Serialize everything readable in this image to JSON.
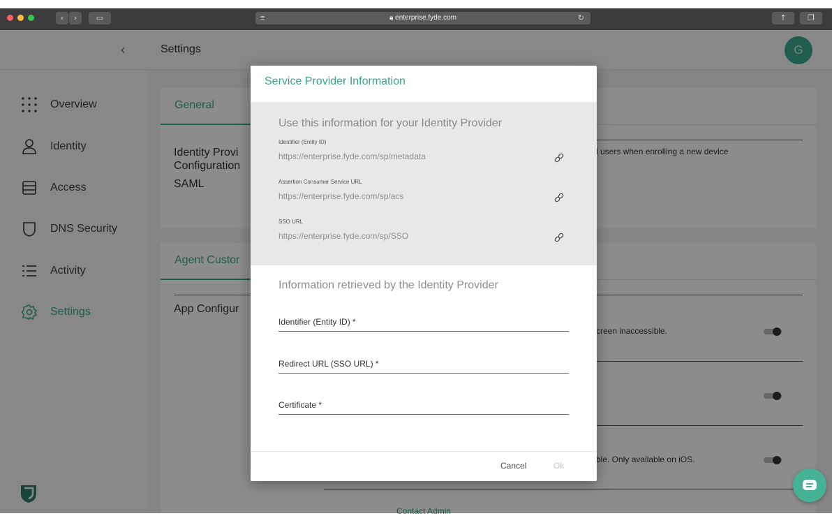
{
  "browser": {
    "url": "enterprise.fyde.com"
  },
  "header": {
    "title": "Settings",
    "avatar_letter": "G"
  },
  "sidebar": {
    "items": [
      {
        "label": "Overview"
      },
      {
        "label": "Identity"
      },
      {
        "label": "Access"
      },
      {
        "label": "DNS Security"
      },
      {
        "label": "Activity"
      },
      {
        "label": "Settings"
      }
    ]
  },
  "background": {
    "general_tab": "General",
    "idp_label_line1": "Identity Provi",
    "idp_label_line2": "Configuration",
    "idp_value": "SAML",
    "idp_desc": "l users when enrolling a new device",
    "agent_tab": "Agent Custor",
    "app_config": "App Configur",
    "row1_desc": "creen inaccessible.",
    "row3_desc": "ble. Only available on iOS.",
    "contact_admin": "Contact Admin"
  },
  "modal": {
    "title": "Service Provider Information",
    "info_heading": "Use this information for your Identity Provider",
    "fields": [
      {
        "label": "Identifier (Entity ID)",
        "value": "https://enterprise.fyde.com/sp/metadata"
      },
      {
        "label": "Assertion Consumer Service URL",
        "value": "https://enterprise.fyde.com/sp/acs"
      },
      {
        "label": "SSO URL",
        "value": "https://enterprise.fyde.com/sp/SSO"
      }
    ],
    "retrieved_heading": "Information retrieved by the Identity Provider",
    "inputs": [
      {
        "placeholder": "Identifier (Entity ID) *"
      },
      {
        "placeholder": "Redirect URL (SSO URL) *"
      },
      {
        "placeholder": "Certificate *"
      }
    ],
    "cancel_label": "Cancel",
    "ok_label": "Ok"
  },
  "colors": {
    "accent": "#3aa48a"
  }
}
